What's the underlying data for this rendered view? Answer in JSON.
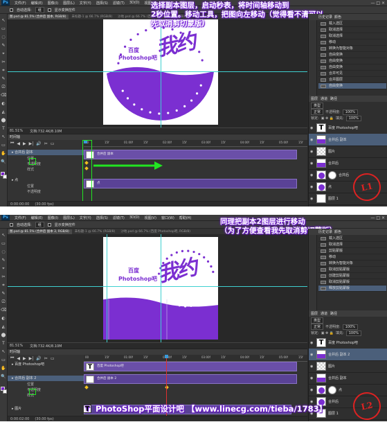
{
  "app": {
    "logo": "Ps",
    "menus": [
      "文件(F)",
      "编辑(E)",
      "图像(I)",
      "图层(L)",
      "文字(Y)",
      "选择(S)",
      "滤镜(T)",
      "3D(D)",
      "视图(V)",
      "窗口(W)",
      "帮助(H)"
    ],
    "window_controls": "— □ ×"
  },
  "options": {
    "auto_select": "自动选择:",
    "target": "组",
    "show_transform": "显示变换控件"
  },
  "colors": {
    "accent": "#7b2fd1",
    "guide": "#3fd0d0",
    "callout_glow": "#7b1fe0",
    "selection": "#4b5f7a",
    "keyframe": "#f0c020",
    "playhead": "#e03030",
    "annotation": "#22e622"
  },
  "shot1": {
    "tabs": [
      "图.psd @ 81.5% (合并后 副本, RGB/8)",
      "未标题-1 @ 66.7% (RGB/8)",
      "沙地.psd @ 66.7% (百度 Photoshop吧, RGB/8)"
    ],
    "doc": {
      "line1": "百度",
      "line2": "Photoshop吧",
      "big": "我约"
    },
    "callout": [
      "选择副本图层，启动秒表，将时间轴移动到",
      "2秒位置。移动工具，把图向左移动（觉得看不清可以",
      "先取消剪切蒙版）"
    ],
    "status": {
      "zoom": "81.51%",
      "doc": "文档:732.4K/8.10M"
    },
    "timeline": {
      "title": "时间轴",
      "controls": [
        "⏮",
        "◀",
        "▶",
        "▶|",
        "🔊",
        "✂",
        "▭"
      ],
      "ticks": [
        "00",
        "15f",
        "01:00f",
        "15f",
        "02:00f",
        "15f",
        "03:00f",
        "15f",
        "04:00f",
        "15f",
        "05:00f",
        "15f"
      ],
      "rows": [
        {
          "label": "▸ 合并后 副本",
          "sel": true
        },
        {
          "label": "▸ 点",
          "sel": false
        }
      ],
      "subs": [
        "位置",
        "不透明度",
        "样式"
      ],
      "subs2": [
        "位置",
        "不透明度"
      ],
      "tracks": [
        "合并后 副本",
        "点"
      ],
      "footer": "0:00:00:00",
      "fps": "(30.00 fps)"
    },
    "history": {
      "tabs": [
        "历史记录",
        "颜色"
      ],
      "items": [
        "载入选区",
        "取消选择",
        "取消选择",
        "移动",
        "转换为智能对象",
        "自由变换",
        "自由变换",
        "自由变换",
        "合并可见",
        "合并图层",
        "自由变换"
      ]
    },
    "layers": {
      "tabs": [
        "图层",
        "通道",
        "路径"
      ],
      "kind": "类型",
      "blend": "正常",
      "opacity_lbl": "不透明度:",
      "opacity": "100%",
      "lock": "锁定:",
      "fill_lbl": "填充:",
      "fill": "100%",
      "rows": [
        {
          "name": "百度 Photoshop吧",
          "thumb": "text"
        },
        {
          "name": "合并后 副本",
          "thumb": "purple",
          "sel": true
        },
        {
          "name": "图片",
          "thumb": "check"
        },
        {
          "name": "合并后",
          "thumb": "purple"
        },
        {
          "name": "合并后",
          "thumb": "circ",
          "mask": true
        },
        {
          "name": "点",
          "thumb": "circ"
        },
        {
          "name": "图层 1",
          "thumb": "plain"
        }
      ]
    },
    "watermark": "L1"
  },
  "shot2": {
    "tabs": [
      "图.psd @ 81.5% (合并后 副本 2, RGB/8)",
      "未标题-1 @ 66.7% (RGB/8)",
      "沙地.psd @ 66.7% (百度 Photoshop吧, RGB/8)"
    ],
    "doc": {
      "line1": "百度",
      "line2": "Photoshop吧",
      "big": "我约"
    },
    "callout": [
      "同理把副本2图层进行移动",
      "（为了方便查看我先取消剪切蒙版）"
    ],
    "status": {
      "zoom": "81.51%",
      "doc": "文档:732.4K/8.10M"
    },
    "timeline": {
      "title": "时间轴",
      "controls": [
        "⏮",
        "◀",
        "▶",
        "▶|",
        "🔊",
        "✂",
        "▭"
      ],
      "ticks": [
        "00",
        "15f",
        "01:00f",
        "15f",
        "02:00f",
        "15f",
        "03:00f",
        "15f",
        "04:00f",
        "15f",
        "05:00f",
        "15f"
      ],
      "rows": [
        {
          "label": "▸ 百度 Photoshop吧",
          "sel": false
        },
        {
          "label": "▸ 合并后 副本 2",
          "sel": true
        },
        {
          "label": "▸ 图片",
          "sel": false
        }
      ],
      "subs": [
        "位置",
        "不透明度",
        "样式"
      ],
      "tracks": [
        "百度 Photoshop吧",
        "合并后 副本 2"
      ],
      "footer": "0:00:02:00",
      "fps": "(30.00 fps)"
    },
    "history": {
      "tabs": [
        "历史记录",
        "颜色"
      ],
      "items": [
        "载入选区",
        "取消选择",
        "剪贴蒙版",
        "移动",
        "转换为智能对象",
        "取消剪贴蒙版",
        "创建剪贴蒙版",
        "取消剪贴蒙版",
        "释放剪贴蒙版"
      ]
    },
    "layers": {
      "tabs": [
        "图层",
        "通道",
        "路径"
      ],
      "kind": "类型",
      "blend": "正常",
      "opacity_lbl": "不透明度:",
      "opacity": "100%",
      "lock": "锁定:",
      "fill_lbl": "填充:",
      "fill": "100%",
      "rows": [
        {
          "name": "百度 Photoshop吧",
          "thumb": "text"
        },
        {
          "name": "合并后 副本 2",
          "thumb": "purple",
          "sel": true
        },
        {
          "name": "图片",
          "thumb": "check"
        },
        {
          "name": "合并后 副本",
          "thumb": "purple"
        },
        {
          "name": "点",
          "thumb": "circ",
          "mask": true
        },
        {
          "name": "合并后",
          "thumb": "circ"
        },
        {
          "name": "图层 1",
          "thumb": "plain"
        }
      ]
    },
    "watermark": "L2"
  },
  "footer_banner": {
    "icon": "T",
    "text": "PhotoShop平面设计吧 【www.linecg.com/tieba/1783】"
  }
}
